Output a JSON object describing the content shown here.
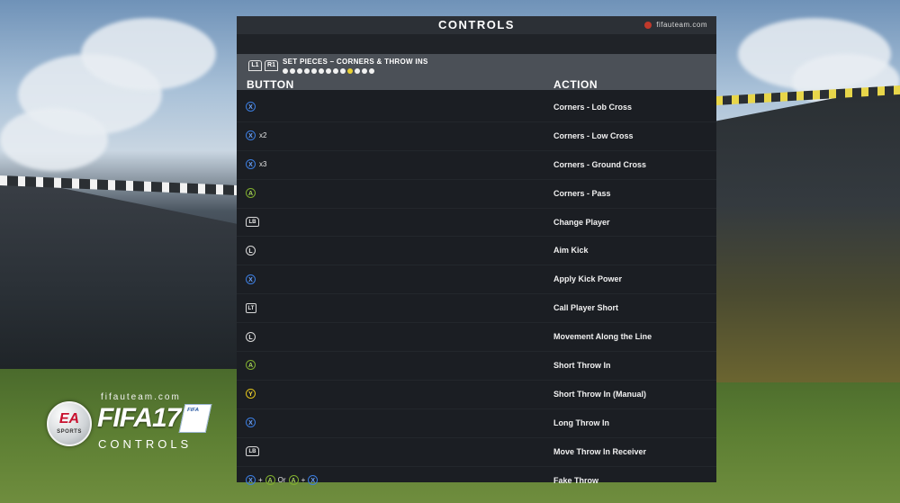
{
  "brand": {
    "site": "fifauteam.com",
    "ea_main": "EA",
    "ea_sub": "SPORTS",
    "fifa_word": "FIFA17",
    "badge_text": "FIFA",
    "subtitle": "CONTROLS"
  },
  "panel": {
    "title": "CONTROLS",
    "site_tag": "fifauteam.com",
    "bumper_left": "L1",
    "bumper_right": "R1",
    "section_title": "SET PIECES – CORNERS & THROW INS",
    "pager_total": 13,
    "pager_active_index": 9,
    "col_button": "BUTTON",
    "col_action": "ACTION"
  },
  "rows": [
    {
      "action": "Corners - Lob Cross"
    },
    {
      "action": "Corners - Low Cross",
      "mult": "x2"
    },
    {
      "action": "Corners - Ground Cross",
      "mult": "x3"
    },
    {
      "action": "Corners - Pass"
    },
    {
      "action": "Change Player"
    },
    {
      "action": "Aim Kick"
    },
    {
      "action": "Apply Kick Power"
    },
    {
      "action": "Call Player Short"
    },
    {
      "action": "Movement Along the Line"
    },
    {
      "action": "Short Throw In"
    },
    {
      "action": "Short Throw In (Manual)"
    },
    {
      "action": "Long Throw In"
    },
    {
      "action": "Move Throw In Receiver"
    },
    {
      "action": "Fake Throw",
      "plus": "+",
      "or": "Or"
    }
  ],
  "glyphs": {
    "x": "X",
    "a": "A",
    "y": "Y",
    "stick": "L",
    "bumper": "LB",
    "trigger": "LT"
  },
  "colors": {
    "panel_bg": "#1b1e23",
    "section_bar": "#4b5057",
    "x_button": "#3b7de0",
    "a_button": "#7fae2e",
    "y_button": "#e0c21a",
    "pager_active": "#e8d031"
  }
}
